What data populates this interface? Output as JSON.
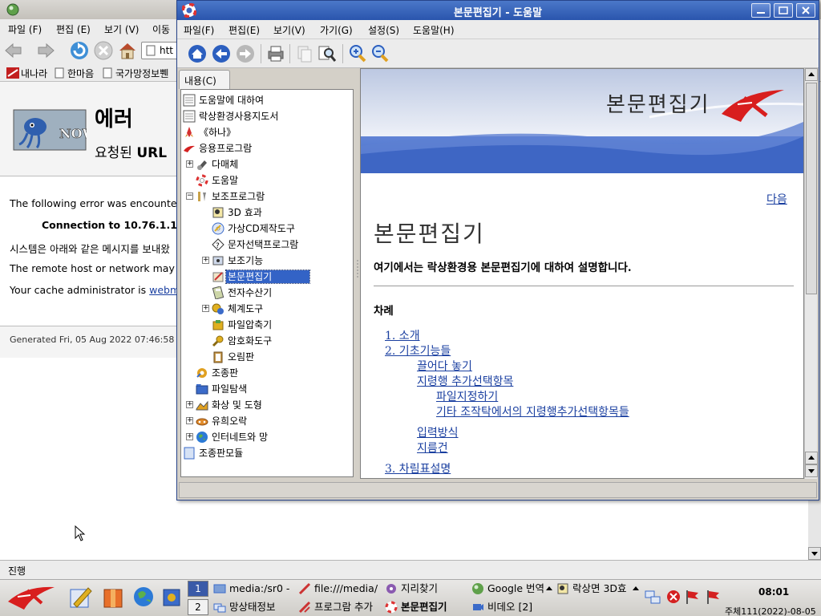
{
  "browser": {
    "menu": [
      "파일 (F)",
      "편집 (E)",
      "보기 (V)",
      "이동"
    ],
    "url_value": "htt",
    "bookmarks": [
      "내나라",
      "한마음",
      "국가망정보쀈"
    ],
    "error": {
      "title": "에러",
      "subtitle_prefix": "요청된",
      "subtitle_bold": "URL",
      "lines": [
        "The following error was encounter",
        "Connection to 10.76.1.1",
        "시스템은 아래와 같은 메시지를 보내왔",
        "The remote host or network may b",
        "Your cache administrator is"
      ],
      "admin_link": "webma",
      "generated": "Generated Fri, 05 Aug 2022 07:46:58 G"
    },
    "status": "진행"
  },
  "help_window": {
    "title": "본문편집기 - 도움말",
    "menu": [
      "파일(F)",
      "편집(E)",
      "보기(V)",
      "가기(G)",
      "설정(S)",
      "도움말(H)"
    ],
    "tab_label": "내용(C)",
    "tree": [
      {
        "label": "도움말에 대하여",
        "icon": "page-icon"
      },
      {
        "label": "락상환경사용지도서",
        "icon": "page-icon"
      },
      {
        "label": "《하나》",
        "icon": "rocket-icon"
      },
      {
        "label": "응용프로그람",
        "icon": "app-logo-icon"
      },
      {
        "label": "다매체",
        "icon": "multimedia-icon"
      },
      {
        "label": "도움말",
        "icon": "lifebuoy-icon"
      },
      {
        "label": "보조프로그람",
        "icon": "tools-icon"
      },
      {
        "label": "3D 효과",
        "icon": "3d-effect-icon"
      },
      {
        "label": "가상CD제작도구",
        "icon": "cd-icon"
      },
      {
        "label": "문자선택프로그람",
        "icon": "character-map-icon"
      },
      {
        "label": "보조기능",
        "icon": "accessibility-icon"
      },
      {
        "label": "본문편집기",
        "icon": "text-editor-icon"
      },
      {
        "label": "전자수산기",
        "icon": "calculator-icon"
      },
      {
        "label": "체계도구",
        "icon": "system-tools-icon"
      },
      {
        "label": "파일압축기",
        "icon": "archive-icon"
      },
      {
        "label": "암호화도구",
        "icon": "key-icon"
      },
      {
        "label": "오림판",
        "icon": "clipboard-icon"
      },
      {
        "label": "조종판",
        "icon": "control-panel-icon"
      },
      {
        "label": "파일탐색",
        "icon": "file-browser-icon"
      },
      {
        "label": "화상 및 도형",
        "icon": "graphics-icon"
      },
      {
        "label": "유희오락",
        "icon": "games-icon"
      },
      {
        "label": "인터네트와 망",
        "icon": "globe-icon"
      },
      {
        "label": "조종판모듈",
        "icon": "page-icon"
      }
    ],
    "doc": {
      "banner_title": "본문편집기",
      "next_link": "다음",
      "heading": "본문편집기",
      "intro": "여기에서는 락상환경용 본문편집기에 대하여 설명합니다.",
      "toc_title": "차례",
      "toc": [
        {
          "text": "1. 소개",
          "level": 1
        },
        {
          "text": "2. 기초기능들",
          "level": 1
        },
        {
          "text": "끌어다 놓기",
          "level": 2
        },
        {
          "text": "지령행 추가선택항목",
          "level": 2
        },
        {
          "text": "파일지정하기",
          "level": 3
        },
        {
          "text": "기타 조작탁에서의 지령행추가선택항목들",
          "level": 3
        },
        {
          "text": "입력방식",
          "level": 2
        },
        {
          "text": "지름건",
          "level": 2
        },
        {
          "text": "3. 차림표설명",
          "level": 1
        }
      ]
    }
  },
  "taskbar": {
    "workspaces": [
      "1",
      "2"
    ],
    "tasks_row1": [
      {
        "label": "media:/sr0 -",
        "icon": "media-icon"
      },
      {
        "label": "file:///media/",
        "icon": "browser-icon"
      },
      {
        "label": "지리찾기",
        "icon": "search-icon"
      },
      {
        "label": "Google 번역",
        "icon": "globe-icon"
      },
      {
        "label": "락상면 3D효",
        "icon": "3d-effect-icon"
      }
    ],
    "tasks_row2": [
      {
        "label": "망상태정보",
        "icon": "network-icon"
      },
      {
        "label": "프로그람 추가",
        "icon": "install-icon"
      },
      {
        "label": "본문편집기",
        "icon": "lifebuoy-icon"
      },
      {
        "label": "비데오 [2]",
        "icon": "video-icon"
      }
    ],
    "clock": "08:01",
    "date": "주체111(2022)-08-05"
  }
}
